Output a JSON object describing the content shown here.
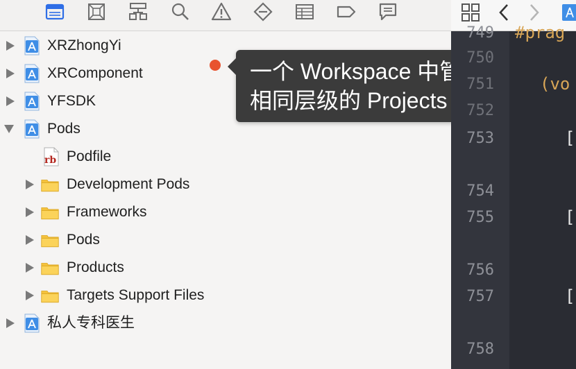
{
  "navigator_toolbar": {
    "icons": [
      "project-navigator-icon",
      "source-control-icon",
      "symbol-navigator-icon",
      "find-navigator-icon",
      "issue-navigator-icon",
      "test-navigator-icon",
      "debug-navigator-icon",
      "breakpoint-navigator-icon",
      "report-navigator-icon"
    ],
    "active_color": "#2f6ee6",
    "icon_color": "#6e6e6e"
  },
  "tree": {
    "items": [
      {
        "label": "XRZhongYi",
        "type": "project",
        "expanded": false
      },
      {
        "label": "XRComponent",
        "type": "project",
        "expanded": false
      },
      {
        "label": "YFSDK",
        "type": "project",
        "expanded": false
      },
      {
        "label": "Pods",
        "type": "project",
        "expanded": true
      },
      {
        "label": "Podfile",
        "type": "file-rb"
      },
      {
        "label": "Development Pods",
        "type": "folder",
        "expanded": false
      },
      {
        "label": "Frameworks",
        "type": "folder",
        "expanded": false
      },
      {
        "label": "Pods",
        "type": "folder",
        "expanded": false
      },
      {
        "label": "Products",
        "type": "folder",
        "expanded": false
      },
      {
        "label": "Targets Support Files",
        "type": "folder",
        "expanded": false
      },
      {
        "label": "私人专科医生",
        "type": "project",
        "expanded": false
      }
    ],
    "rb_badge": "rb"
  },
  "tooltip": {
    "text": "一个 Workspace 中管理的相同层级的 Projects"
  },
  "editor": {
    "line_numbers": [
      "749",
      "750",
      "751",
      "752",
      "753",
      "754",
      "755",
      "756",
      "757",
      "758"
    ],
    "code_fragments": {
      "pragma": "#prag",
      "void": "(vo",
      "bracket": "["
    }
  }
}
